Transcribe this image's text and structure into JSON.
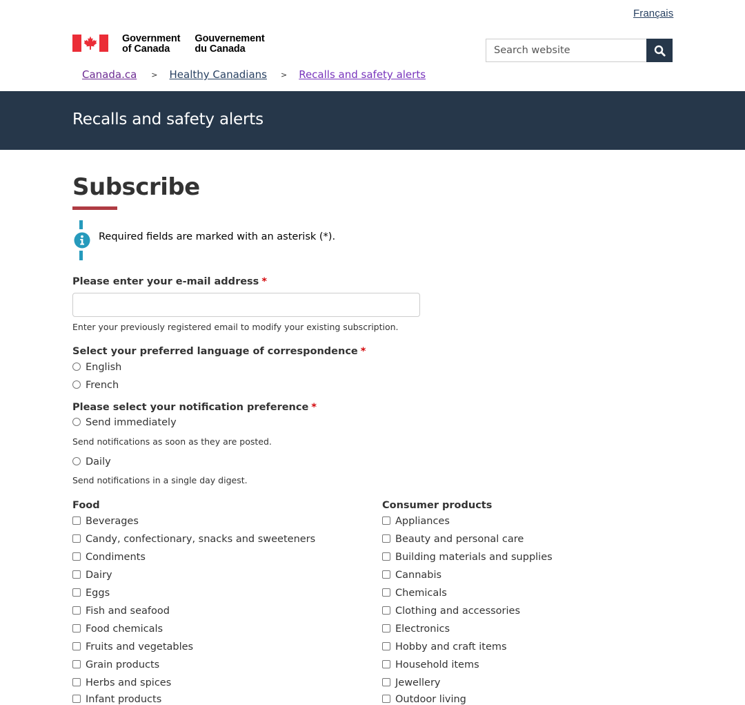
{
  "header": {
    "language_toggle": "Français",
    "brand": {
      "en_line1": "Government",
      "en_line2": "of Canada",
      "fr_line1": "Gouvernement",
      "fr_line2": "du Canada"
    },
    "search": {
      "placeholder": "Search website",
      "button_icon": "search-icon"
    }
  },
  "breadcrumb": {
    "items": [
      "Canada.ca",
      "Healthy Canadians",
      "Recalls and safety alerts"
    ],
    "separator": ">"
  },
  "banner": {
    "title": "Recalls and safety alerts"
  },
  "colors": {
    "banner_bg": "#26374a",
    "title_underline": "#af3c43",
    "info_accent": "#269abc",
    "required_star": "#d3080c",
    "flag_red": "#eb2d37"
  },
  "main": {
    "title": "Subscribe",
    "info_message": "Required fields are marked with an asterisk (*).",
    "email": {
      "label": "Please enter your e-mail address",
      "required_mark": "*",
      "value": "",
      "help": "Enter your previously registered email to modify your existing subscription."
    },
    "language": {
      "label": "Select your preferred language of correspondence",
      "required_mark": "*",
      "options": [
        "English",
        "French"
      ]
    },
    "notification": {
      "label": "Please select your notification preference",
      "required_mark": "*",
      "options": [
        {
          "label": "Send immediately",
          "help": "Send notifications as soon as they are posted."
        },
        {
          "label": "Daily",
          "help": "Send notifications in a single day digest."
        }
      ]
    },
    "food": {
      "heading": "Food",
      "items": [
        "Beverages",
        "Candy, confectionary, snacks and sweeteners",
        "Condiments",
        "Dairy",
        "Eggs",
        "Fish and seafood",
        "Food chemicals",
        "Fruits and vegetables",
        "Grain products",
        "Herbs and spices",
        "Infant products"
      ]
    },
    "consumer_products": {
      "heading": "Consumer products",
      "items": [
        "Appliances",
        "Beauty and personal care",
        "Building materials and supplies",
        "Cannabis",
        "Chemicals",
        "Clothing and accessories",
        "Electronics",
        "Hobby and craft items",
        "Household items",
        "Jewellery",
        "Outdoor living"
      ]
    }
  }
}
